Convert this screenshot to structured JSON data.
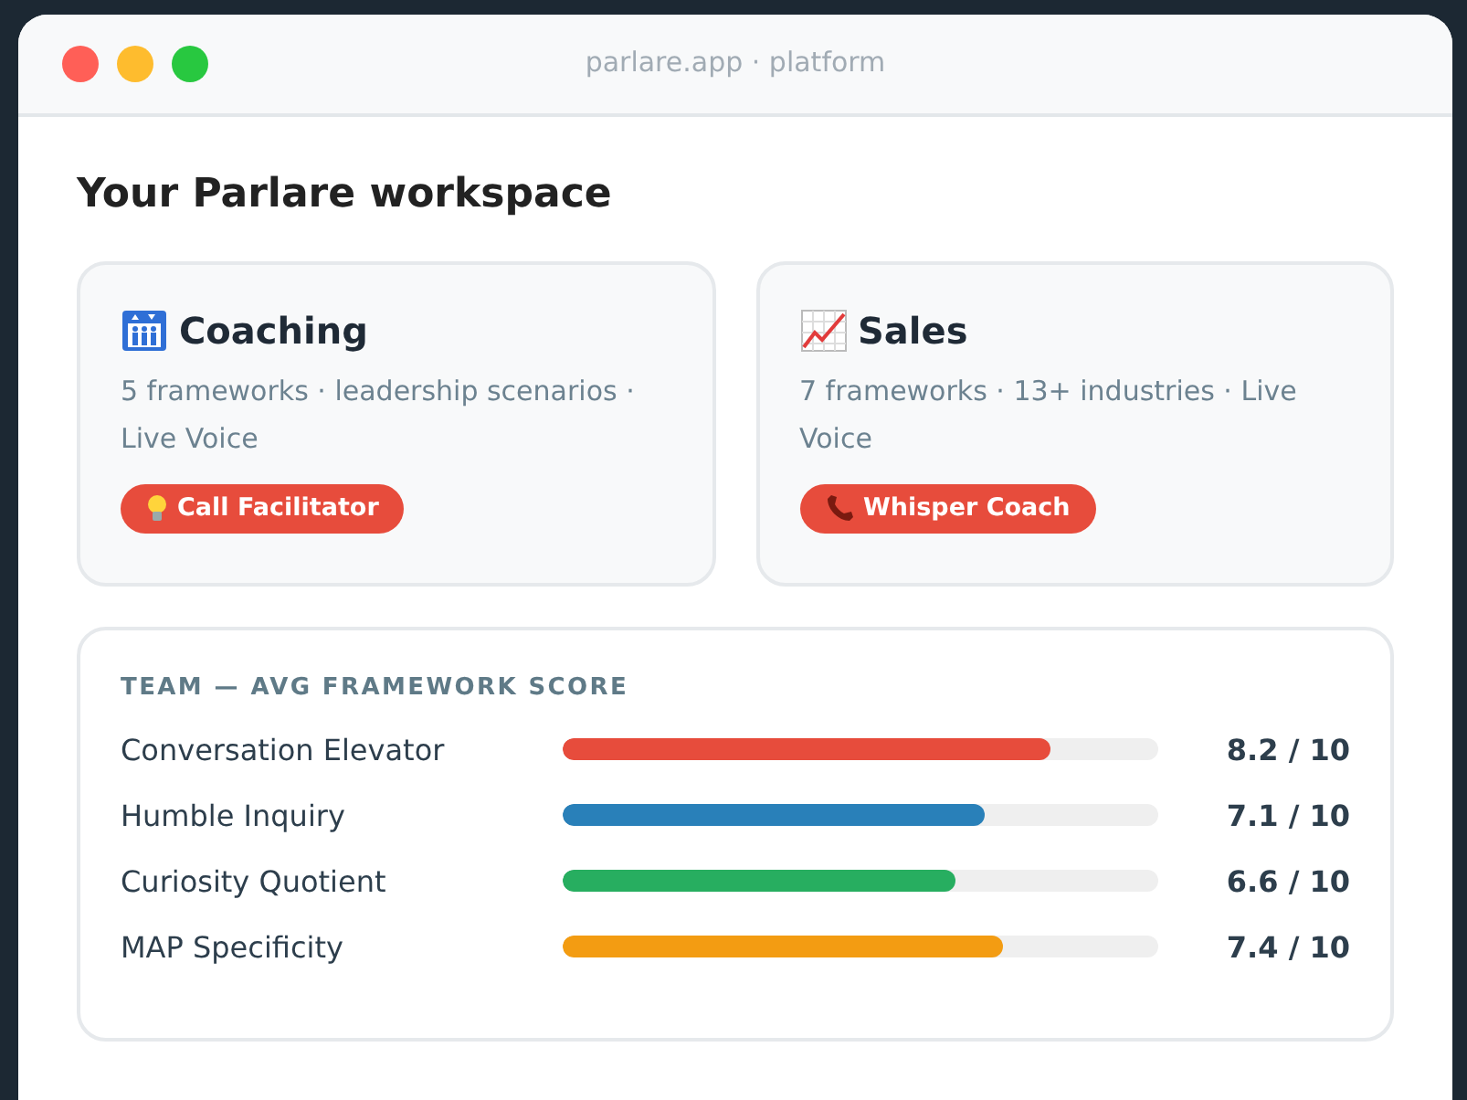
{
  "window": {
    "title": "parlare.app · platform"
  },
  "heading": "Your Parlare workspace",
  "products": [
    {
      "title": "Coaching",
      "description": "5 frameworks · leadership scenarios · Live Voice",
      "action": "Call Facilitator"
    },
    {
      "title": "Sales",
      "description": "7 frameworks · 13+ industries · Live Voice",
      "action": "Whisper Coach"
    }
  ],
  "scores": {
    "title": "TEAM — AVG FRAMEWORK SCORE",
    "rows": [
      {
        "name": "Conversation Elevator",
        "level": 0.82,
        "color": "#e74c3c",
        "reading": "8.2 / 10"
      },
      {
        "name": "Humble Inquiry",
        "level": 0.71,
        "color": "#2980b9",
        "reading": "7.1 / 10"
      },
      {
        "name": "Curiosity Quotient",
        "level": 0.66,
        "color": "#27ae60",
        "reading": "6.6 / 10"
      },
      {
        "name": "MAP Specificity",
        "level": 0.74,
        "color": "#f39c12",
        "reading": "7.4 / 10"
      }
    ]
  }
}
